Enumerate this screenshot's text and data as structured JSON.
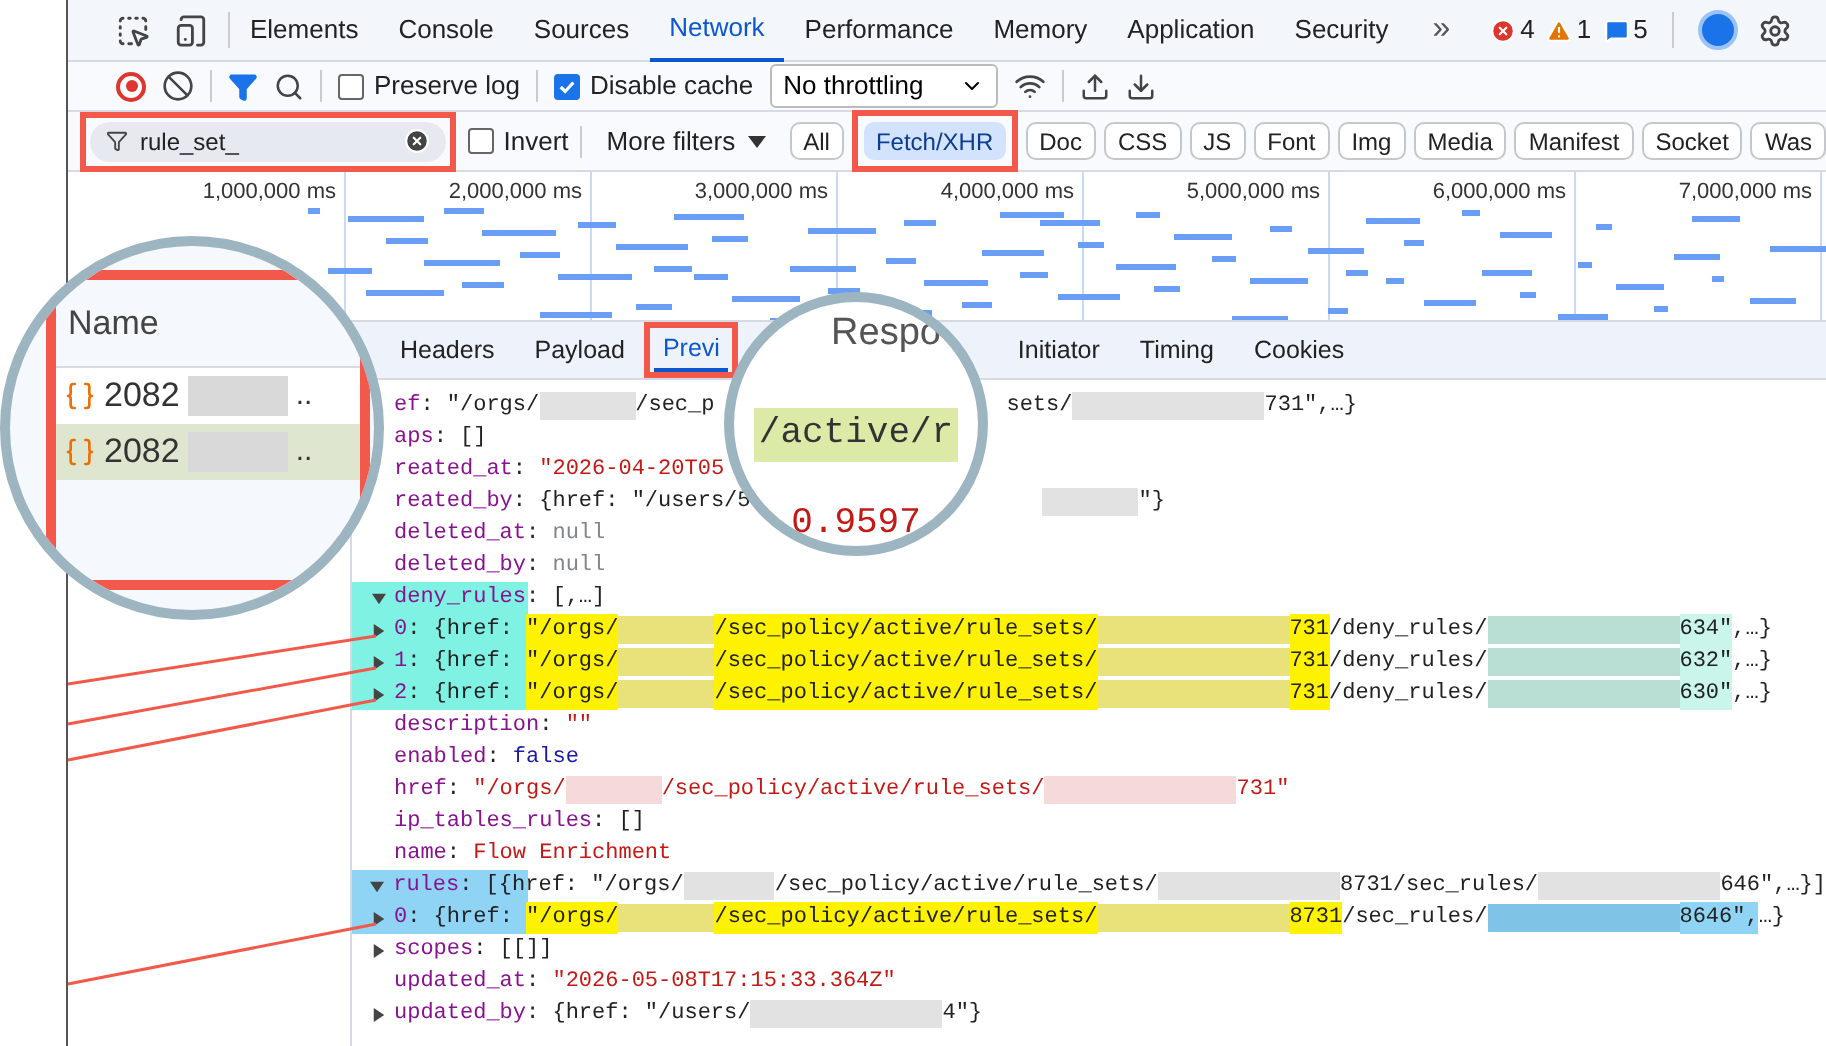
{
  "main_tabs": [
    {
      "label": "Elements",
      "selected": false
    },
    {
      "label": "Console",
      "selected": false
    },
    {
      "label": "Sources",
      "selected": false
    },
    {
      "label": "Network",
      "selected": true
    },
    {
      "label": "Performance",
      "selected": false
    },
    {
      "label": "Memory",
      "selected": false
    },
    {
      "label": "Application",
      "selected": false
    },
    {
      "label": "Security",
      "selected": false
    }
  ],
  "more_tabs": "»",
  "counts": {
    "errors": "4",
    "warnings": "1",
    "messages": "5"
  },
  "toolbar": {
    "recording": true,
    "filter_active": true,
    "preserve_log": {
      "label": "Preserve log",
      "checked": false
    },
    "disable_cache": {
      "label": "Disable cache",
      "checked": true
    },
    "throttling": "No throttling"
  },
  "filter_bar": {
    "query": "rule_set_",
    "invert": {
      "label": "Invert",
      "checked": false
    },
    "more_filters": "More filters",
    "types": [
      {
        "label": "All",
        "selected": false,
        "framed": false
      },
      {
        "label": "Fetch/XHR",
        "selected": true,
        "framed": true
      },
      {
        "label": "Doc",
        "selected": false,
        "framed": false
      },
      {
        "label": "CSS",
        "selected": false,
        "framed": false
      },
      {
        "label": "JS",
        "selected": false,
        "framed": false
      },
      {
        "label": "Font",
        "selected": false,
        "framed": false
      },
      {
        "label": "Img",
        "selected": false,
        "framed": false
      },
      {
        "label": "Media",
        "selected": false,
        "framed": false
      },
      {
        "label": "Manifest",
        "selected": false,
        "framed": false
      },
      {
        "label": "Socket",
        "selected": false,
        "framed": false
      },
      {
        "label": "Was",
        "selected": false,
        "framed": false
      }
    ]
  },
  "timeline": {
    "ticks": [
      "1,000,000 ms",
      "2,000,000 ms",
      "3,000,000 ms",
      "4,000,000 ms",
      "5,000,000 ms",
      "6,000,000 ms",
      "7,000,000 ms"
    ]
  },
  "detail_tabs": [
    {
      "label": "Headers",
      "selected": false,
      "framed": false
    },
    {
      "label": "Payload",
      "selected": false,
      "framed": false
    },
    {
      "label": "Previ",
      "selected": true,
      "framed": true
    },
    {
      "label": "Initiator",
      "selected": false,
      "framed": false
    },
    {
      "label": "Timing",
      "selected": false,
      "framed": false
    },
    {
      "label": "Cookies",
      "selected": false,
      "framed": false
    }
  ],
  "preview_lines": [
    {
      "parts": [
        {
          "kind": "key",
          "text": "ef"
        },
        {
          "kind": "text",
          "text": ": \"/orgs/"
        },
        {
          "kind": "blur"
        },
        {
          "kind": "text",
          "text": "/sec_p"
        },
        {
          "kind": "covered"
        },
        {
          "kind": "text",
          "text": "sets/"
        },
        {
          "kind": "blurlong"
        },
        {
          "kind": "text",
          "text": "731\",…}"
        }
      ]
    },
    {
      "parts": [
        {
          "kind": "key",
          "text": "aps"
        },
        {
          "kind": "text",
          "text": ": []"
        }
      ]
    },
    {
      "parts": [
        {
          "kind": "key",
          "text": "reated_at"
        },
        {
          "kind": "text",
          "text": ": "
        },
        {
          "kind": "str",
          "text": "\"2026-04-20T05"
        }
      ]
    },
    {
      "parts": [
        {
          "kind": "key",
          "text": "reated_by"
        },
        {
          "kind": "text",
          "text": ": {href: \"/users/5"
        },
        {
          "kind": "covered"
        },
        {
          "kind": "blur"
        },
        {
          "kind": "text",
          "text": "\"}"
        }
      ]
    },
    {
      "parts": [
        {
          "kind": "key",
          "text": "deleted_at"
        },
        {
          "kind": "text",
          "text": ": "
        },
        {
          "kind": "null",
          "text": "null"
        }
      ]
    },
    {
      "parts": [
        {
          "kind": "key",
          "text": "deleted_by"
        },
        {
          "kind": "text",
          "text": ": "
        },
        {
          "kind": "null",
          "text": "null"
        }
      ]
    },
    {
      "expanded": true,
      "color": "#7ff2e4",
      "parts": [
        {
          "kind": "key",
          "text": "deny_rules"
        },
        {
          "kind": "text",
          "text": ": [,…]"
        }
      ]
    },
    {
      "expanded": false,
      "color": "#7ff2e4",
      "parts": [
        {
          "kind": "key",
          "text": "0"
        },
        {
          "kind": "text",
          "text": ": {href: "
        },
        {
          "kind": "text",
          "text": "\"/orgs/",
          "color": "#fff200"
        },
        {
          "kind": "blur",
          "color": "#e9e27a"
        },
        {
          "kind": "text",
          "text": "/sec_policy/active/rule_sets/",
          "color": "#fff200"
        },
        {
          "kind": "blurlong",
          "color": "#e9e27a"
        },
        {
          "kind": "text",
          "text": "731",
          "color": "#fff200"
        },
        {
          "kind": "text",
          "text": "/deny_rules/"
        },
        {
          "kind": "blurlong",
          "color": "#b9dfd4"
        },
        {
          "kind": "text",
          "text": "634\"",
          "color": "#c9f5ea"
        },
        {
          "kind": "text",
          "text": ",…}"
        }
      ]
    },
    {
      "expanded": false,
      "color": "#7ff2e4",
      "parts": [
        {
          "kind": "key",
          "text": "1"
        },
        {
          "kind": "text",
          "text": ": {href: "
        },
        {
          "kind": "text",
          "text": "\"/orgs/",
          "color": "#fff200"
        },
        {
          "kind": "blur",
          "color": "#e9e27a"
        },
        {
          "kind": "text",
          "text": "/sec_policy/active/rule_sets/",
          "color": "#fff200"
        },
        {
          "kind": "blurlong",
          "color": "#e9e27a"
        },
        {
          "kind": "text",
          "text": "731",
          "color": "#fff200"
        },
        {
          "kind": "text",
          "text": "/deny_rules/"
        },
        {
          "kind": "blurlong",
          "color": "#b9dfd4"
        },
        {
          "kind": "text",
          "text": "632\"",
          "color": "#c9f5ea"
        },
        {
          "kind": "text",
          "text": ",…}"
        }
      ]
    },
    {
      "expanded": false,
      "color": "#7ff2e4",
      "parts": [
        {
          "kind": "key",
          "text": "2"
        },
        {
          "kind": "text",
          "text": ": {href: "
        },
        {
          "kind": "text",
          "text": "\"/orgs/",
          "color": "#fff200"
        },
        {
          "kind": "blur",
          "color": "#e9e27a"
        },
        {
          "kind": "text",
          "text": "/sec_policy/active/rule_sets/",
          "color": "#fff200"
        },
        {
          "kind": "blurlong",
          "color": "#e9e27a"
        },
        {
          "kind": "text",
          "text": "731",
          "color": "#fff200"
        },
        {
          "kind": "text",
          "text": "/deny_rules/"
        },
        {
          "kind": "blurlong",
          "color": "#b9dfd4"
        },
        {
          "kind": "text",
          "text": "630\"",
          "color": "#c9f5ea"
        },
        {
          "kind": "text",
          "text": ",…}"
        }
      ]
    },
    {
      "parts": [
        {
          "kind": "key",
          "text": "description"
        },
        {
          "kind": "text",
          "text": ": "
        },
        {
          "kind": "str",
          "text": "\"\""
        }
      ]
    },
    {
      "parts": [
        {
          "kind": "key",
          "text": "enabled"
        },
        {
          "kind": "text",
          "text": ": "
        },
        {
          "kind": "bool",
          "text": "false"
        }
      ]
    },
    {
      "parts": [
        {
          "kind": "key",
          "text": "href"
        },
        {
          "kind": "text",
          "text": ": "
        },
        {
          "kind": "str",
          "text": "\"/orgs/"
        },
        {
          "kind": "blur",
          "color": "#f6d9d9"
        },
        {
          "kind": "str",
          "text": "/sec_policy/active/rule_sets/"
        },
        {
          "kind": "blurlong",
          "color": "#f6d9d9"
        },
        {
          "kind": "str",
          "text": "731\""
        }
      ]
    },
    {
      "parts": [
        {
          "kind": "key",
          "text": "ip_tables_rules"
        },
        {
          "kind": "text",
          "text": ": []"
        }
      ]
    },
    {
      "parts": [
        {
          "kind": "key",
          "text": "name"
        },
        {
          "kind": "text",
          "text": ": "
        },
        {
          "kind": "str",
          "text": "Flow Enrichment"
        }
      ]
    },
    {
      "expanded": true,
      "color": "#8fd3f5",
      "parts": [
        {
          "kind": "key",
          "text": "rules"
        },
        {
          "kind": "text",
          "text": ": [{href: \"/orgs/"
        },
        {
          "kind": "blur"
        },
        {
          "kind": "text",
          "text": "/sec_policy/active/rule_sets/"
        },
        {
          "kind": "blurlong"
        },
        {
          "kind": "text",
          "text": "8731/sec_rules/"
        },
        {
          "kind": "blurlong"
        },
        {
          "kind": "text",
          "text": "646\",…}]"
        }
      ]
    },
    {
      "expanded": false,
      "color": "#8fd3f5",
      "parts": [
        {
          "kind": "key",
          "text": "0"
        },
        {
          "kind": "text",
          "text": ": {href: "
        },
        {
          "kind": "text",
          "text": "\"/orgs/",
          "color": "#fff200"
        },
        {
          "kind": "blur",
          "color": "#e9e27a"
        },
        {
          "kind": "text",
          "text": "/sec_policy/active/rule_sets/",
          "color": "#fff200"
        },
        {
          "kind": "blurlong",
          "color": "#e9e27a"
        },
        {
          "kind": "text",
          "text": "8731",
          "color": "#fff200"
        },
        {
          "kind": "text",
          "text": "/sec_rules/"
        },
        {
          "kind": "blurlong",
          "color": "#7fc3e6"
        },
        {
          "kind": "text",
          "text": "8646\",",
          "color": "#8fd3f5"
        },
        {
          "kind": "text",
          "text": "…}"
        }
      ]
    },
    {
      "expanded": false,
      "parts": [
        {
          "kind": "key",
          "text": "scopes"
        },
        {
          "kind": "text",
          "text": ": [[]]"
        }
      ]
    },
    {
      "parts": [
        {
          "kind": "key",
          "text": "updated_at"
        },
        {
          "kind": "text",
          "text": ": "
        },
        {
          "kind": "str",
          "text": "\"2026-05-08T17:15:33.364Z\""
        }
      ]
    },
    {
      "expanded": false,
      "parts": [
        {
          "kind": "key",
          "text": "updated_by"
        },
        {
          "kind": "text",
          "text": ": {href: \"/users/"
        },
        {
          "kind": "blurlong"
        },
        {
          "kind": "text",
          "text": "4\"}"
        }
      ]
    }
  ],
  "magnifier_left": {
    "header": "Name",
    "rows": [
      {
        "name": "2082",
        "suffix": "..",
        "selected": false
      },
      {
        "name": "2082",
        "suffix": "..",
        "selected": true
      }
    ]
  },
  "magnifier_right": {
    "tab": "Respo",
    "path": "/active/r",
    "number": "0.9597"
  }
}
